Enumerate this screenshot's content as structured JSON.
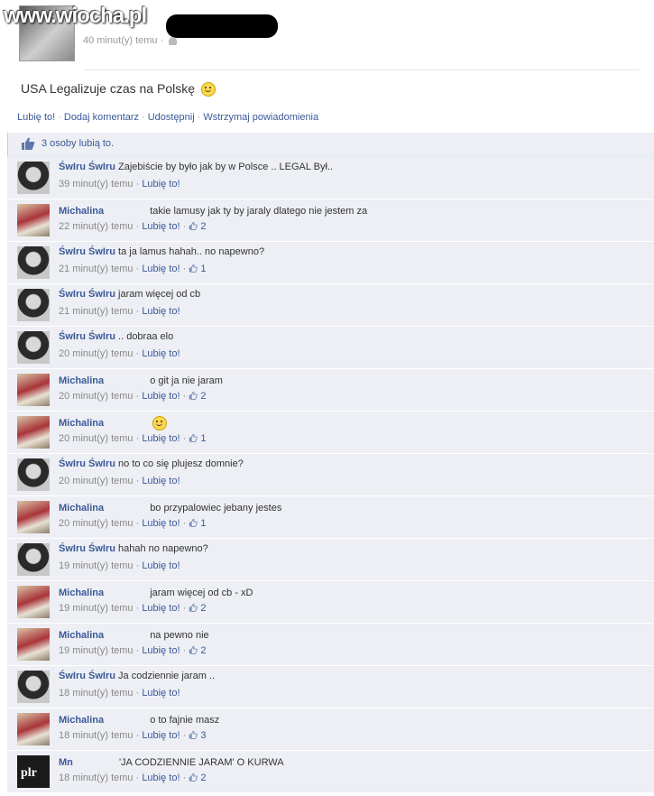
{
  "watermark": "www.wiocha.pl",
  "post": {
    "time": "40 minut(y) temu",
    "text": "USA Legalizuje czas na Polskę"
  },
  "actions": {
    "like": "Lubię to!",
    "comment": "Dodaj komentarz",
    "share": "Udostępnij",
    "stop": "Wstrzymaj powiadomienia"
  },
  "likes_text": "3 osoby lubią to.",
  "like_label": "Lubię to!",
  "comments": [
    {
      "author": "ŚwIru ŚwIru",
      "avatar": "swiru",
      "text": "Zajebiście by było jak by w Polsce .. LEGAL Był..",
      "time": "39 minut(y) temu",
      "likes": ""
    },
    {
      "author": "Michalina",
      "avatar": "michalina",
      "text": "takie lamusy jak ty by jaraly dlatego nie jestem za",
      "time": "22 minut(y) temu",
      "likes": "2"
    },
    {
      "author": "ŚwIru ŚwIru",
      "avatar": "swiru",
      "text": "ta ja lamus hahah.. no napewno?",
      "time": "21 minut(y) temu",
      "likes": "1"
    },
    {
      "author": "ŚwIru ŚwIru",
      "avatar": "swiru",
      "text": "jaram więcej od cb",
      "time": "21 minut(y) temu",
      "likes": ""
    },
    {
      "author": "ŚwIru ŚwIru",
      "avatar": "swiru",
      "text": ".. dobraa elo",
      "time": "20 minut(y) temu",
      "likes": ""
    },
    {
      "author": "Michalina",
      "avatar": "michalina",
      "text": "o git ja nie jaram",
      "time": "20 minut(y) temu",
      "likes": "2"
    },
    {
      "author": "Michalina",
      "avatar": "michalina",
      "text": "",
      "smiley": true,
      "time": "20 minut(y) temu",
      "likes": "1"
    },
    {
      "author": "ŚwIru ŚwIru",
      "avatar": "swiru",
      "text": "no to co się plujesz domnie?",
      "time": "20 minut(y) temu",
      "likes": ""
    },
    {
      "author": "Michalina",
      "avatar": "michalina",
      "text": "bo przypalowiec jebany jestes",
      "time": "20 minut(y) temu",
      "likes": "1"
    },
    {
      "author": "ŚwIru ŚwIru",
      "avatar": "swiru",
      "text": "hahah no napewno?",
      "time": "19 minut(y) temu",
      "likes": ""
    },
    {
      "author": "Michalina",
      "avatar": "michalina",
      "text": "jaram więcej od cb - xD",
      "time": "19 minut(y) temu",
      "likes": "2"
    },
    {
      "author": "Michalina",
      "avatar": "michalina",
      "text": "na pewno nie",
      "time": "19 minut(y) temu",
      "likes": "2"
    },
    {
      "author": "ŚwIru ŚwIru",
      "avatar": "swiru",
      "text": "Ja codziennie jaram ..",
      "time": "18 minut(y) temu",
      "likes": ""
    },
    {
      "author": "Michalina",
      "avatar": "michalina",
      "text": "o to fajnie masz",
      "time": "18 minut(y) temu",
      "likes": "3"
    },
    {
      "author": "Mn",
      "avatar": "ppr",
      "text": "'JA CODZIENNIE JARAM' O KURWA",
      "time": "18 minut(y) temu",
      "likes": "2"
    }
  ]
}
